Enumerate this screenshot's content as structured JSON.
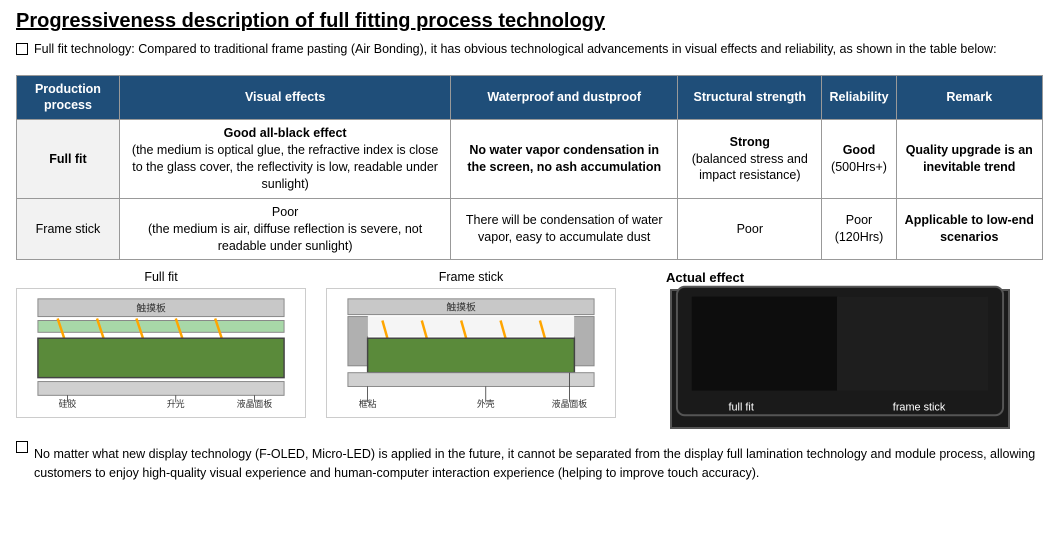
{
  "title": "Progressiveness description of full fitting process technology",
  "intro": "Full fit technology: Compared to traditional frame pasting (Air Bonding), it has obvious technological advancements in visual effects and reliability, as shown in the table below:",
  "table": {
    "headers": [
      "Production process",
      "Visual effects",
      "Waterproof and dustproof",
      "Structural strength",
      "Reliability",
      "Remark"
    ],
    "rows": [
      {
        "process": "Full fit",
        "visual": "Good all-black effect\n(the medium is optical glue, the refractive index is close to the glass cover, the reflectivity is low, readable under sunlight)",
        "waterproof": "No water vapor condensation in the screen, no ash accumulation",
        "strength": "Strong\n(balanced stress and impact resistance)",
        "reliability": "Good\n(500Hrs+)",
        "remark": "Quality upgrade is an inevitable trend"
      },
      {
        "process": "Frame stick",
        "visual": "Poor\n(the medium is air, diffuse reflection is severe, not readable under sunlight)",
        "waterproof": "There will be condensation of water vapor, easy to accumulate dust",
        "strength": "Poor",
        "reliability": "Poor\n(120Hrs)",
        "remark": "Applicable to low-end scenarios"
      }
    ]
  },
  "diagrams": {
    "fullfit_label": "Full fit",
    "framestick_label": "Frame stick",
    "actual_effect_label": "Actual effect",
    "fullfit_parts": [
      "触摸板",
      "硅胶",
      "升光",
      "液晶面板"
    ],
    "framestick_parts": [
      "触摸板",
      "框粘",
      "外壳",
      "液晶面板"
    ],
    "actual_label_fit": "full fit",
    "actual_label_frame": "frame stick"
  },
  "footer": "No matter what new display technology (F-OLED, Micro-LED) is applied in the future, it cannot be separated from the display full lamination technology and module process, allowing customers to enjoy high-quality visual experience and human-computer interaction experience (helping to improve touch accuracy)."
}
